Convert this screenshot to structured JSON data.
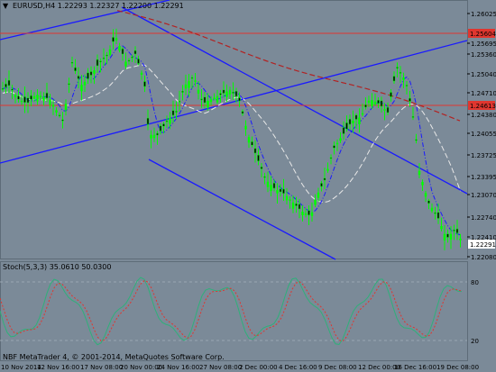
{
  "chart": {
    "symbol": "EURUSD,H4",
    "ohlc": "1.22293 1.22327 1.22200 1.22291",
    "header": "EURUSD,H4  1.22293 1.22327 1.22200 1.22291",
    "price_labels": [
      "1.26025",
      "1.25695",
      "1.25360",
      "1.25040",
      "1.24710",
      "1.24380",
      "1.24055",
      "1.23725",
      "1.23395",
      "1.23070",
      "1.22740",
      "1.22410",
      "1.22080"
    ],
    "marker_labels": [
      {
        "text": "1.25604",
        "color": "#e0362f"
      },
      {
        "text": "1.24613",
        "color": "#e0362f"
      },
      {
        "text": "1.22291",
        "color": "#ffffff"
      }
    ],
    "date_labels": [
      "10 Nov 2014",
      "12 Nov 16:00",
      "17 Nov 08:00",
      "20 Nov 00:00",
      "24 Nov 16:00",
      "27 Nov 08:00",
      "2 Dec 00:00",
      "4 Dec 16:00",
      "9 Dec 08:00",
      "12 Dec 00:00",
      "16 Dec 16:00",
      "19 Dec 08:00"
    ],
    "stoch_title": "Stoch(5,3,3) 35.0610 50.0300",
    "stoch_levels": [
      "80",
      "20"
    ],
    "footer": "NBF MetaTrader 4, © 2001-2014, MetaQuotes Software Corp."
  },
  "colors": {
    "background": "#7b8a98",
    "candle": "#00ff00",
    "channel": "#1a1aff",
    "resistance": "#e0362f",
    "ma_red": "#b22222",
    "ma_white": "#e8e8e8",
    "ma_blue": "#1a1aff",
    "stoch_main": "#2fb07a",
    "stoch_signal": "#e0362f"
  }
}
